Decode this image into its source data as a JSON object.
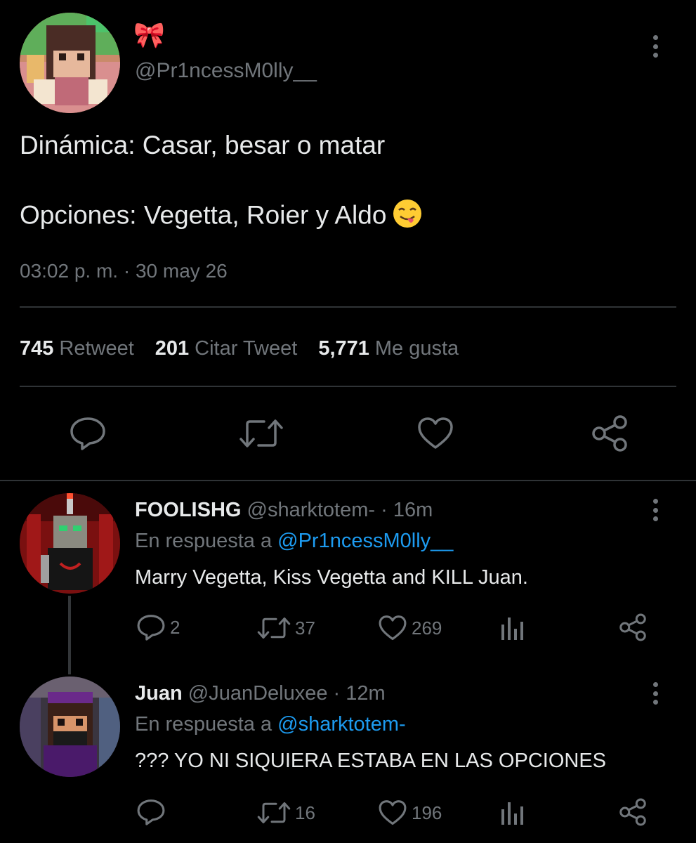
{
  "main_tweet": {
    "display_name_emoji": "🎀",
    "handle": "@Pr1ncessM0lly__",
    "text_line1": "Dinámica: Casar, besar o matar",
    "text_line2": "Opciones: Vegetta, Roier y Aldo",
    "timestamp": "03:02 p. m. · 30 may 26",
    "stats": {
      "retweets": "745",
      "retweets_label": "Retweet",
      "quotes": "201",
      "quotes_label": "Citar Tweet",
      "likes": "5,771",
      "likes_label": "Me gusta"
    }
  },
  "replies": [
    {
      "name": "FOOLISHG",
      "handle": "@sharktotem-",
      "time": "· 16m",
      "reply_prefix": "En respuesta a",
      "reply_to": "@Pr1ncessM0lly__",
      "text": "Marry Vegetta, Kiss Vegetta and KILL Juan.",
      "comments": "2",
      "retweets": "37",
      "likes": "269"
    },
    {
      "name": "Juan",
      "handle": "@JuanDeluxee",
      "time": "· 12m",
      "reply_prefix": "En respuesta a",
      "reply_to": "@sharktotem-",
      "text": "??? YO NI SIQUIERA ESTABA EN LAS OPCIONES",
      "comments": "",
      "retweets": "16",
      "likes": "196"
    }
  ],
  "icons": [
    "more-icon",
    "reply-icon",
    "retweet-icon",
    "like-icon",
    "share-icon",
    "analytics-icon"
  ],
  "colors": {
    "background": "#000000",
    "text": "#e7e9ea",
    "muted": "#71767b",
    "link": "#1d9bf0",
    "divider": "#2f3336"
  }
}
